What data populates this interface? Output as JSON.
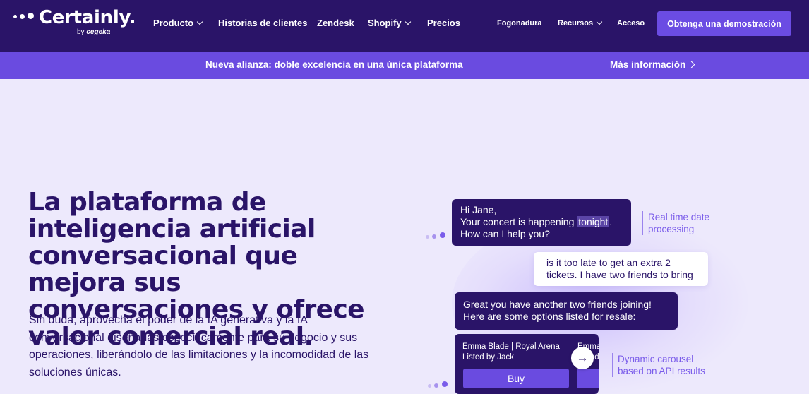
{
  "nav": {
    "logo_word": "Certainly.",
    "logo_by": "by",
    "logo_partner": "cegeka",
    "items": [
      {
        "label": "Producto",
        "dropdown": true
      },
      {
        "label": "Historias de clientes",
        "dropdown": false
      },
      {
        "label": "Zendesk",
        "dropdown": false
      },
      {
        "label": "Shopify",
        "dropdown": true
      },
      {
        "label": "Precios",
        "dropdown": false
      }
    ],
    "right_items": [
      {
        "label": "Fogonadura",
        "dropdown": false
      },
      {
        "label": "Recursos",
        "dropdown": true
      },
      {
        "label": "Acceso",
        "dropdown": false
      }
    ],
    "cta": "Obtenga una demostración"
  },
  "banner": {
    "text": "Nueva alianza: doble excelencia en una única plataforma",
    "link": "Más información"
  },
  "hero": {
    "title": "La plataforma de inteligencia artificial conversacional que mejora sus conversaciones y ofrece valor comercial real.",
    "subtitle": "Sin duda, aprovecha el poder de la IA generativa y la IA conversacional diseñadas específicamente para su negocio y sus operaciones, liberándolo de las limitaciones y la incomodidad de las soluciones únicas."
  },
  "chat": {
    "bot1_line1": "Hi Jane,",
    "bot1_line2_pre": "Your concert is happening ",
    "bot1_highlight": "tonight",
    "bot1_line2_post": ".",
    "bot1_line3": "How can I help you?",
    "user1": "is it too late to get an extra 2 tickets. I have two friends to bring",
    "bot2": "Great you have another two friends joining! Here are some options listed for resale:",
    "card_title": "Emma Blade | Royal Arena",
    "card_listed": "Listed by Jack",
    "card_buy": "Buy",
    "card2_title_partial": "Emma",
    "card2_listed_partial": "Listed",
    "annotation1": "Real time date processing",
    "annotation2": "Dynamic carousel based on API results"
  },
  "colors": {
    "nav_bg": "#2a1468",
    "banner_bg": "#6a4be0",
    "page_bg": "#ede9fc",
    "accent": "#6b4ce3",
    "annotation": "#7a5cea"
  }
}
